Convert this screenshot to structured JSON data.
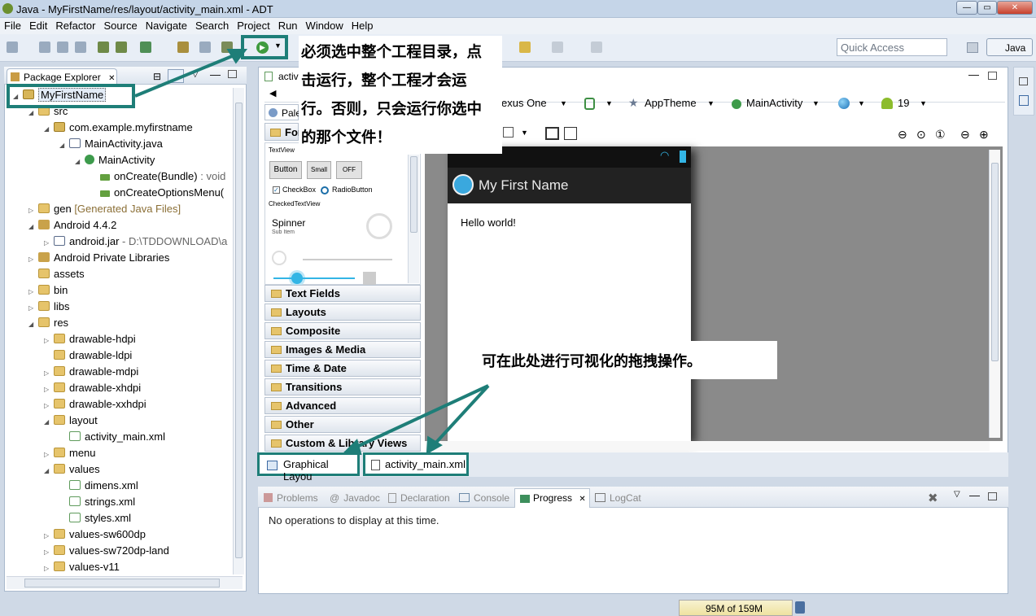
{
  "window": {
    "title": "Java - MyFirstName/res/layout/activity_main.xml - ADT",
    "min": "—",
    "max": "▭",
    "close": "✕"
  },
  "menu": [
    "File",
    "Edit",
    "Refactor",
    "Source",
    "Navigate",
    "Search",
    "Project",
    "Run",
    "Window",
    "Help"
  ],
  "toolbar": {
    "quick_access_placeholder": "Quick Access",
    "perspective": "Java"
  },
  "package_explorer": {
    "tab": "Package Explorer",
    "tree": [
      {
        "label": "MyFirstName",
        "level": 0,
        "icon": "project",
        "selected": true
      },
      {
        "label": "src",
        "level": 1,
        "icon": "folder"
      },
      {
        "label": "com.example.myfirstname",
        "level": 2,
        "icon": "package"
      },
      {
        "label": "MainActivity.java",
        "level": 3,
        "icon": "java"
      },
      {
        "label": "MainActivity",
        "level": 4,
        "icon": "class"
      },
      {
        "label": "onCreate(Bundle)",
        "suffix": " : void",
        "level": 5,
        "icon": "method"
      },
      {
        "label": "onCreateOptionsMenu(",
        "level": 5,
        "icon": "method"
      },
      {
        "label": "gen",
        "suffix": " [Generated Java Files]",
        "level": 1,
        "icon": "folder"
      },
      {
        "label": "Android 4.4.2",
        "level": 1,
        "icon": "lib"
      },
      {
        "label": "android.jar",
        "suffix": " - D:\\TDDOWNLOAD\\a",
        "level": 2,
        "icon": "jar"
      },
      {
        "label": "Android Private Libraries",
        "level": 1,
        "icon": "lib"
      },
      {
        "label": "assets",
        "level": 1,
        "icon": "folder"
      },
      {
        "label": "bin",
        "level": 1,
        "icon": "folder"
      },
      {
        "label": "libs",
        "level": 1,
        "icon": "folder"
      },
      {
        "label": "res",
        "level": 1,
        "icon": "folder"
      },
      {
        "label": "drawable-hdpi",
        "level": 2,
        "icon": "folder"
      },
      {
        "label": "drawable-ldpi",
        "level": 2,
        "icon": "folder"
      },
      {
        "label": "drawable-mdpi",
        "level": 2,
        "icon": "folder"
      },
      {
        "label": "drawable-xhdpi",
        "level": 2,
        "icon": "folder"
      },
      {
        "label": "drawable-xxhdpi",
        "level": 2,
        "icon": "folder"
      },
      {
        "label": "layout",
        "level": 2,
        "icon": "folder"
      },
      {
        "label": "activity_main.xml",
        "level": 3,
        "icon": "xml"
      },
      {
        "label": "menu",
        "level": 2,
        "icon": "folder"
      },
      {
        "label": "values",
        "level": 2,
        "icon": "folder"
      },
      {
        "label": "dimens.xml",
        "level": 3,
        "icon": "xml"
      },
      {
        "label": "strings.xml",
        "level": 3,
        "icon": "xml"
      },
      {
        "label": "styles.xml",
        "level": 3,
        "icon": "xml"
      },
      {
        "label": "values-sw600dp",
        "level": 2,
        "icon": "folder"
      },
      {
        "label": "values-sw720dp-land",
        "level": 2,
        "icon": "folder"
      },
      {
        "label": "values-v11",
        "level": 2,
        "icon": "folder"
      }
    ]
  },
  "editor": {
    "tab": "activ",
    "palette_tab": "Pale",
    "form_widgets": "For",
    "device_bar": {
      "device": "exus One",
      "theme": "AppTheme",
      "activity": "MainActivity",
      "api": "19"
    },
    "widgets": {
      "textview": "TextView",
      "button": "Button",
      "small": "Small",
      "off": "OFF",
      "checkbox": "CheckBox",
      "radio": "RadioButton",
      "checked_textview": "CheckedTextView",
      "spinner": "Spinner",
      "sub_item": "Sub Item"
    },
    "palette_sections": [
      "Text Fields",
      "Layouts",
      "Composite",
      "Images & Media",
      "Time & Date",
      "Transitions",
      "Advanced",
      "Other",
      "Custom & Library Views"
    ],
    "app_title": "My First Name",
    "hello": "Hello world!",
    "bottom_tabs": {
      "graphical": "Graphical Layou",
      "xml": "activity_main.xml"
    }
  },
  "console": {
    "tabs": [
      "Problems",
      "Javadoc",
      "Declaration",
      "Console",
      "Progress",
      "LogCat"
    ],
    "active": "Progress",
    "message": "No operations to display at this time."
  },
  "status": {
    "memory": "95M of 159M"
  },
  "annotations": {
    "run_note": [
      "必须选中整个工程目录，点",
      "击运行，整个工程才会运",
      "行。否则，只会运行你选中",
      "的那个文件！"
    ],
    "drag_note": "可在此处进行可视化的拖拽操作。"
  },
  "colors": {
    "accent": "#1e7e78",
    "action_bar": "#222222",
    "canvas": "#8a8a8a"
  }
}
